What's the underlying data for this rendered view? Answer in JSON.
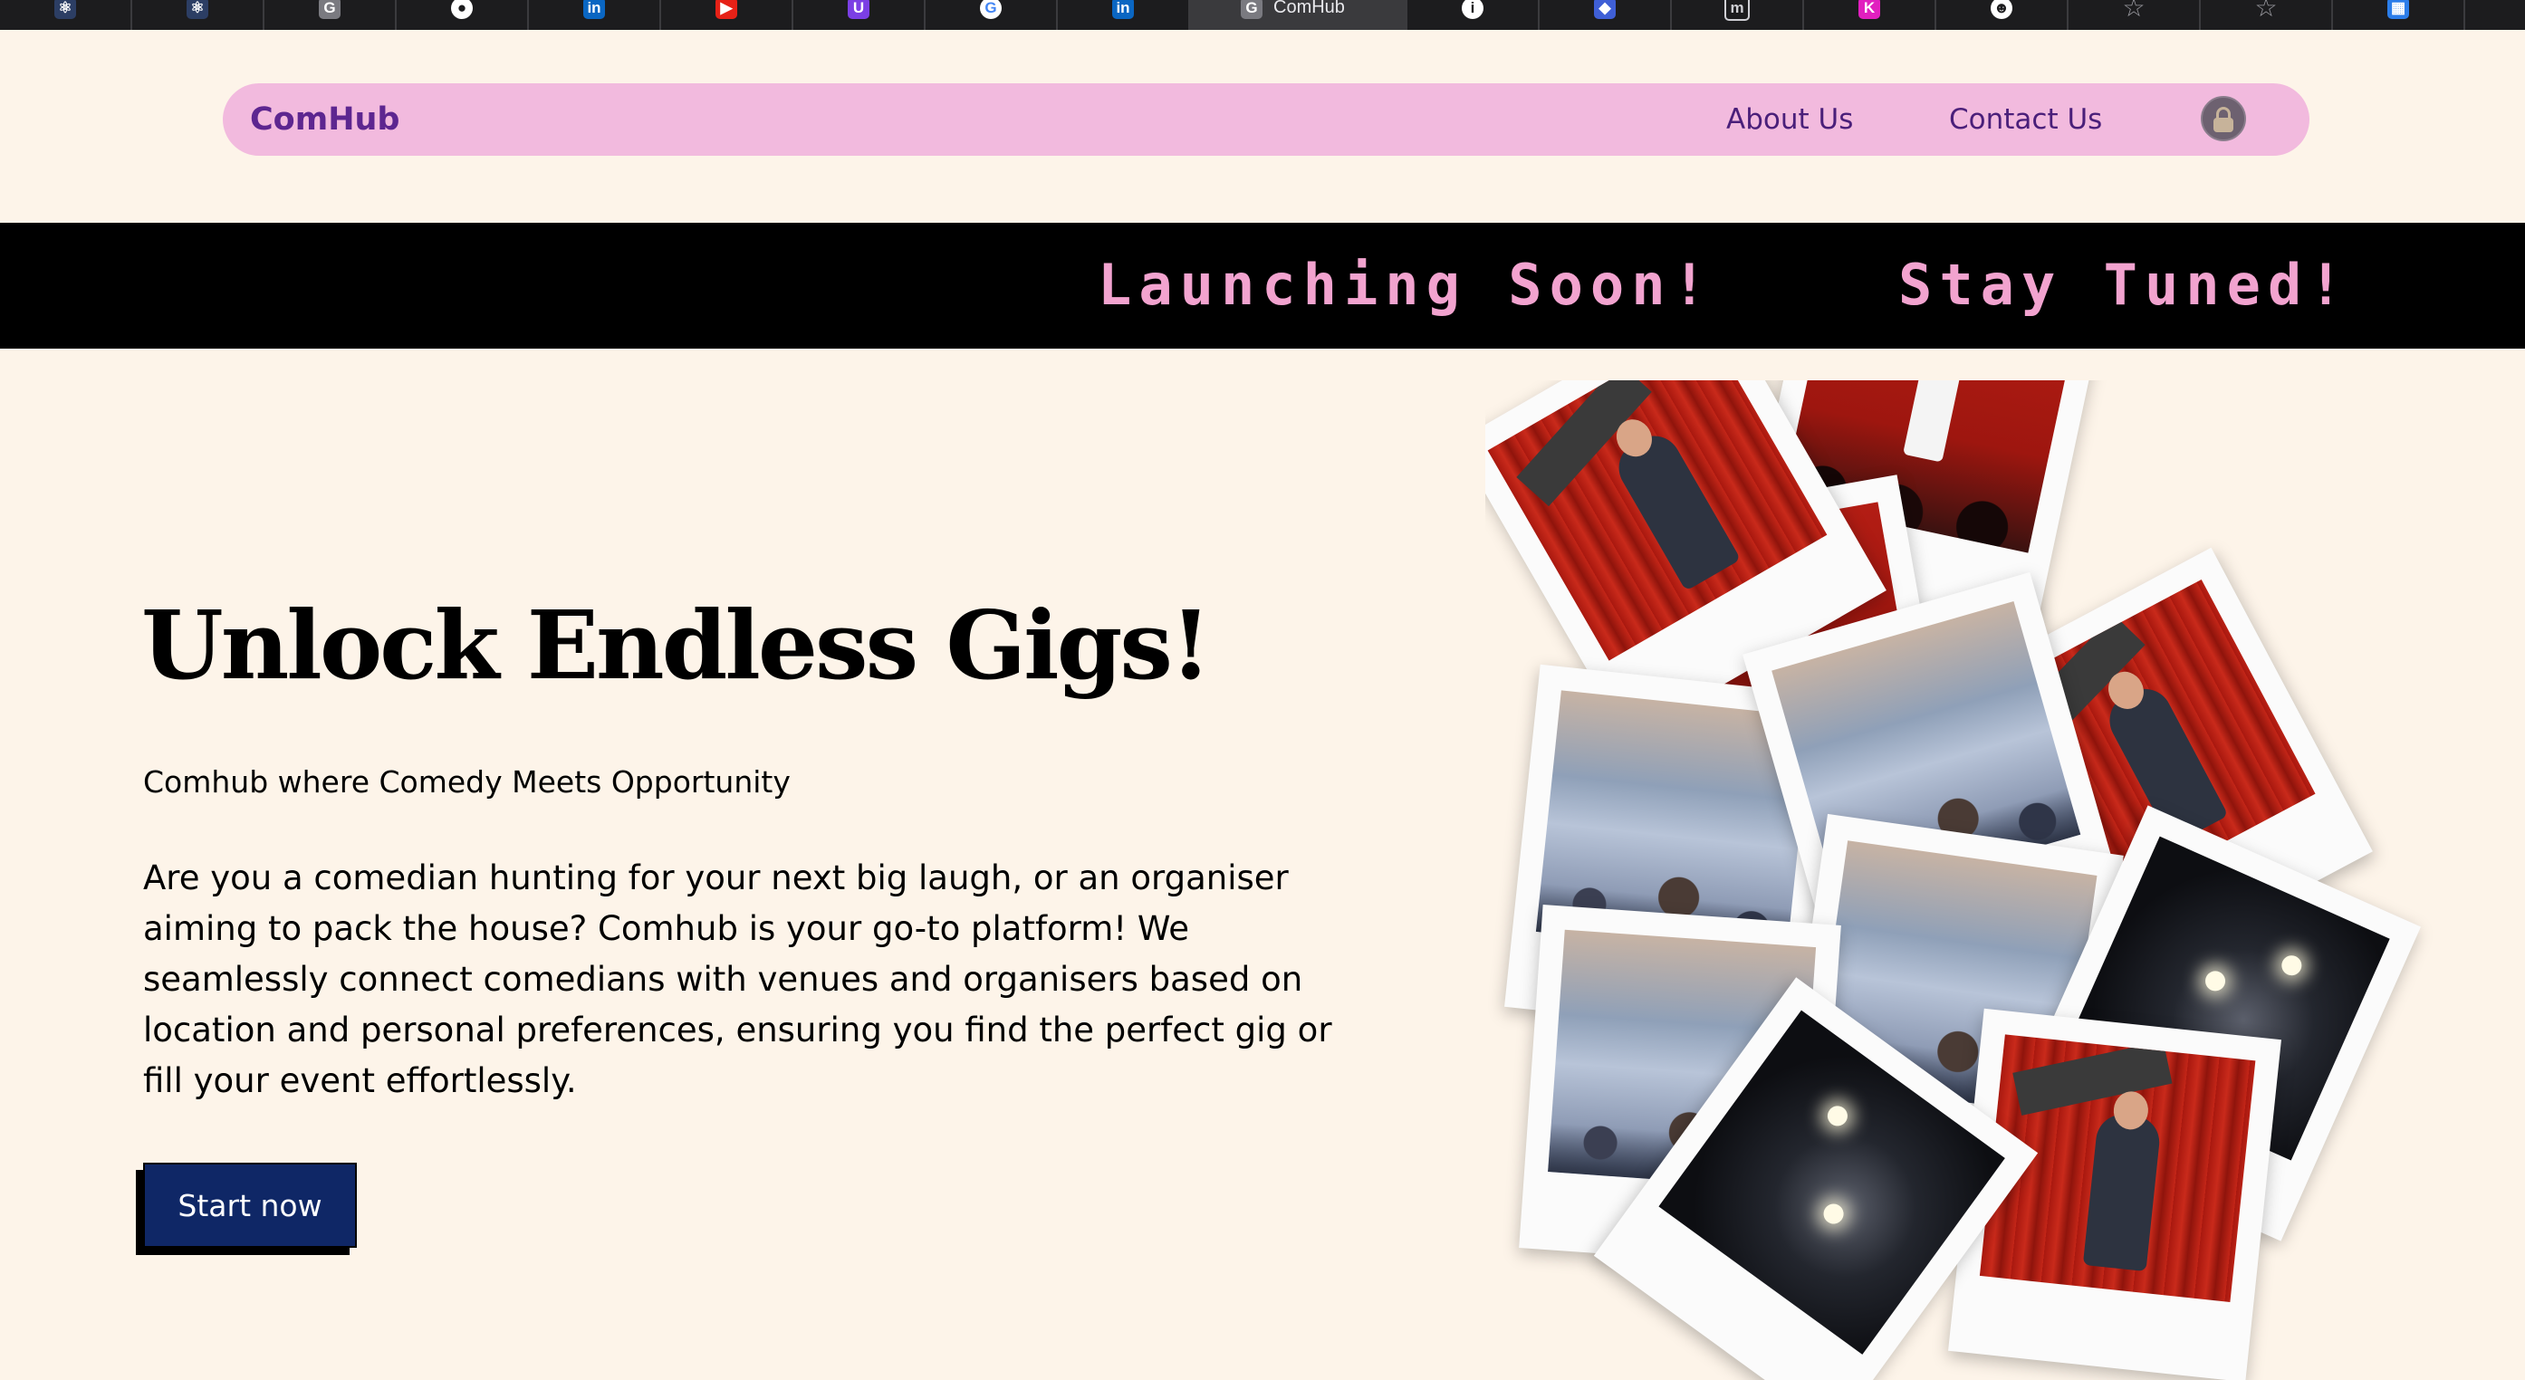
{
  "browser": {
    "tabs": [
      {
        "icon": "react-icon",
        "glyph": "⚛",
        "color": "#2c3e64"
      },
      {
        "icon": "react-icon",
        "glyph": "⚛",
        "color": "#2c3e64"
      },
      {
        "icon": "g-letter-icon",
        "glyph": "G",
        "color": "#7a7a80"
      },
      {
        "icon": "github-icon",
        "glyph": "●",
        "color": "#1c1c1e"
      },
      {
        "icon": "linkedin-icon",
        "glyph": "in",
        "color": "#0a66c2"
      },
      {
        "icon": "youtube-icon",
        "glyph": "▶",
        "color": "#e62117"
      },
      {
        "icon": "u-letter-icon",
        "glyph": "U",
        "color": "#7b3fe4"
      },
      {
        "icon": "google-icon",
        "glyph": "G",
        "color": "#ffffff"
      },
      {
        "icon": "linkedin-icon",
        "glyph": "in",
        "color": "#0a66c2"
      },
      {
        "icon": "g-letter-icon",
        "glyph": "G",
        "color": "#7a7a80",
        "title": "ComHub",
        "active": true
      },
      {
        "icon": "info-icon",
        "glyph": "i",
        "color": "#ffffff"
      },
      {
        "icon": "app-icon",
        "glyph": "◆",
        "color": "#3f5fd6"
      },
      {
        "icon": "m-letter-icon",
        "glyph": "m",
        "color": "#1c1c1e"
      },
      {
        "icon": "k-letter-icon",
        "glyph": "K",
        "color": "#e11fbf"
      },
      {
        "icon": "smiley-icon",
        "glyph": "☻",
        "color": "#1c1c1e"
      },
      {
        "icon": "star-icon",
        "glyph": "☆",
        "color": "transparent"
      },
      {
        "icon": "star-icon",
        "glyph": "☆",
        "color": "transparent"
      },
      {
        "icon": "microsoft-icon",
        "glyph": "▦",
        "color": "#2b7de9"
      }
    ]
  },
  "navbar": {
    "brand": "ComHub",
    "links": {
      "about": "About Us",
      "contact": "Contact Us"
    }
  },
  "marquee": {
    "first": "Launching Soon!",
    "second": "Stay Tuned!"
  },
  "hero": {
    "title": "Unlock Endless Gigs!",
    "subtitle": "Comhub where Comedy Meets Opportunity",
    "body": "Are you a comedian hunting for your next big laugh, or an organiser aiming to pack the house? Comhub is your go-to platform! We seamlessly connect comedians with venues and organisers based on location and personal preferences, ensuring you find the perfect gig or fill your event effortlessly.",
    "cta_label": "Start now"
  },
  "colors": {
    "page_bg": "#fdf4e9",
    "navbar_bg": "#f2bade",
    "brand": "#5d2690",
    "marquee_bg": "#000000",
    "marquee_text": "#f2a3cf",
    "cta_bg": "#0f2766"
  }
}
